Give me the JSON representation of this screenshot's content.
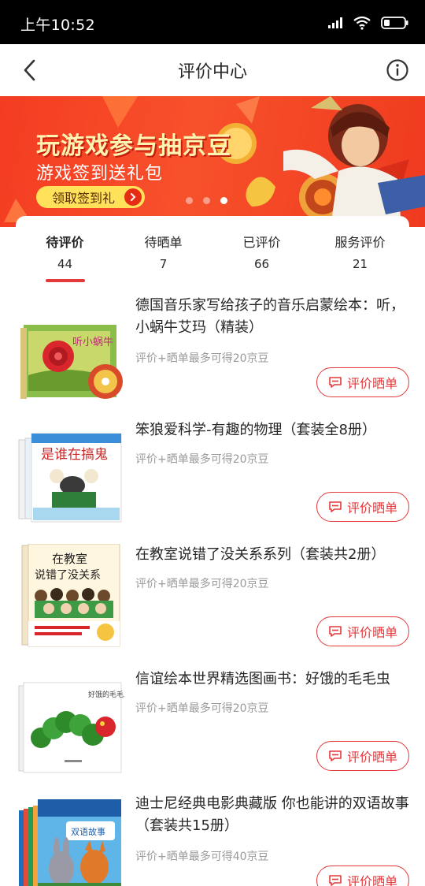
{
  "status_bar": {
    "time": "上午10:52",
    "icons": [
      "signal-icon",
      "wifi-icon",
      "battery-icon"
    ]
  },
  "nav": {
    "title": "评价中心",
    "back_icon": "back-arrow-icon",
    "info_icon": "info-icon"
  },
  "banner": {
    "title": "玩游戏参与抽京豆",
    "subtitle": "游戏签到送礼包",
    "button_label": "领取签到礼",
    "dot_count": 3,
    "active_dot": 2
  },
  "tabs": [
    {
      "label": "待评价",
      "count": "44",
      "active": true
    },
    {
      "label": "待晒单",
      "count": "7",
      "active": false
    },
    {
      "label": "已评价",
      "count": "66",
      "active": false
    },
    {
      "label": "服务评价",
      "count": "21",
      "active": false
    }
  ],
  "colors": {
    "accent": "#e4393c",
    "banner": "#f43c22",
    "banner_button": "#ffe15a",
    "hint": "#9a9a9a"
  },
  "products": [
    {
      "title": "德国音乐家写给孩子的音乐启蒙绘本：听，小蜗牛艾玛（精装）",
      "hint": "评价+晒单最多可得20京豆",
      "button_label": "评价晒单",
      "button_icon": "comment-icon"
    },
    {
      "title": "笨狼爱科学-有趣的物理（套装全8册）",
      "hint": "评价+晒单最多可得20京豆",
      "button_label": "评价晒单",
      "button_icon": "comment-icon"
    },
    {
      "title": "在教室说错了没关系系列（套装共2册）",
      "hint": "评价+晒单最多可得20京豆",
      "button_label": "评价晒单",
      "button_icon": "comment-icon"
    },
    {
      "title": "信谊绘本世界精选图画书：好饿的毛毛虫",
      "hint": "评价+晒单最多可得20京豆",
      "button_label": "评价晒单",
      "button_icon": "comment-icon"
    },
    {
      "title": "迪士尼经典电影典藏版 你也能讲的双语故事（套装共15册）",
      "hint": "评价+晒单最多可得40京豆",
      "button_label": "评价晒单",
      "button_icon": "comment-icon"
    }
  ]
}
